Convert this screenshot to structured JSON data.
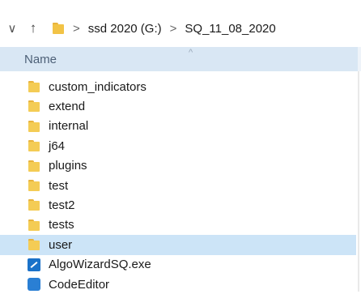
{
  "address_bar": {
    "chevron_icon": "chevron-down-icon",
    "up_icon": "arrow-up-icon",
    "separator": ">",
    "crumbs": [
      "ssd 2020 (G:)",
      "SQ_11_08_2020"
    ]
  },
  "header": {
    "name_label": "Name",
    "sort_indicator": "^"
  },
  "files": [
    {
      "name": "custom_indicators",
      "type": "folder"
    },
    {
      "name": "extend",
      "type": "folder"
    },
    {
      "name": "internal",
      "type": "folder"
    },
    {
      "name": "j64",
      "type": "folder"
    },
    {
      "name": "plugins",
      "type": "folder"
    },
    {
      "name": "test",
      "type": "folder"
    },
    {
      "name": "test2",
      "type": "folder"
    },
    {
      "name": "tests",
      "type": "folder"
    },
    {
      "name": "user",
      "type": "folder",
      "selected": true
    },
    {
      "name": "AlgoWizardSQ.exe",
      "type": "exe"
    },
    {
      "name": "CodeEditor",
      "type": "app"
    }
  ],
  "colors": {
    "selection": "#cce4f7",
    "header_bg": "#d9e7f4",
    "folder": "#f4cc55"
  }
}
